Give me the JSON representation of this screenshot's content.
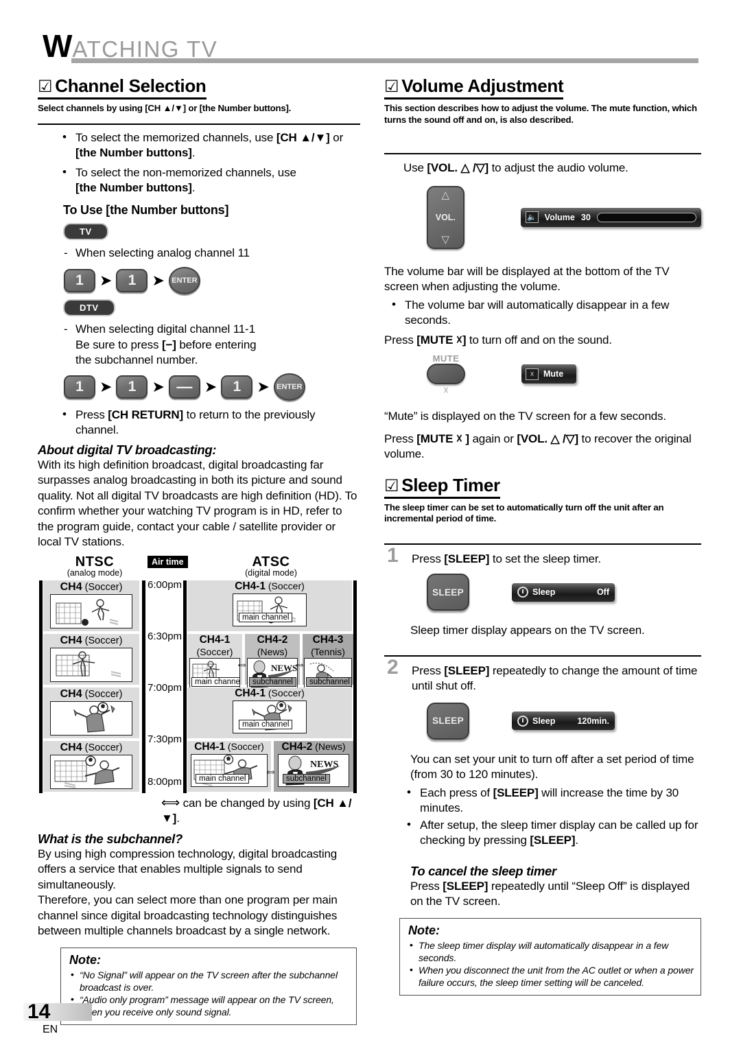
{
  "header": {
    "cap": "W",
    "rest": "ATCHING  TV"
  },
  "left": {
    "section1": {
      "check": "☑",
      "title": "Channel Selection",
      "lead": "Select channels by using [CH ▲/▼] or [the Number buttons].",
      "b1_a": "To select the memorized channels, use ",
      "b1_b": "[CH ▲/▼]",
      "b1_c": " or",
      "b1_d": "[the Number buttons]",
      "b1_e": ".",
      "b2_a": "To select the non-memorized channels, use",
      "b2_b": "[the Number buttons]",
      "b2_c": ".",
      "subhead": "To Use [the Number buttons]",
      "badge_tv": "TV",
      "badge_dtv": "DTV",
      "analog_line": "When selecting analog channel 11",
      "digital_line1": "When selecting digital channel 11-1",
      "digital_line2_a": "Be sure to press ",
      "digital_line2_b": "[−]",
      "digital_line2_c": " before entering",
      "digital_line3": "the subchannel number.",
      "keys_analog": [
        "1",
        "1",
        "ENTER"
      ],
      "keys_digital": [
        "1",
        "1",
        "—",
        "1",
        "ENTER"
      ],
      "b3_a": "Press ",
      "b3_b": "[CH RETURN]",
      "b3_c": " to return to the previously",
      "b3_d": "channel.",
      "about_head": "About digital TV broadcasting:",
      "about_body": "With its high definition broadcast, digital broadcasting far surpasses analog broadcasting in both its picture and sound quality. Not all digital TV broadcasts are high definition (HD). To confirm whether your watching TV program is in HD, refer to the program guide, contact your cable / satellite provider or local TV stations.",
      "sub_head": "What is the subchannel?",
      "sub_p1": "By using high compression technology, digital broadcasting offers a service that enables multiple signals to send simultaneously.",
      "sub_p2": "Therefore, you can select more than one program per main channel since digital broadcasting technology distinguishes between multiple channels broadcast by a single network."
    },
    "diagram": {
      "ntsc_title": "NTSC",
      "ntsc_sub": "(analog mode)",
      "atsc_title": "ATSC",
      "atsc_sub": "(digital mode)",
      "airtime": "Air time",
      "times": [
        "6:00pm",
        "6:30pm",
        "7:00pm",
        "7:30pm",
        "8:00pm"
      ],
      "ntsc_cells": [
        {
          "ch": "CH4",
          "prog": "(Soccer)"
        },
        {
          "ch": "CH4",
          "prog": "(Soccer)"
        },
        {
          "ch": "CH4",
          "prog": "(Soccer)"
        },
        {
          "ch": "CH4",
          "prog": "(Soccer)"
        }
      ],
      "atsc_cells": [
        {
          "ch": "CH4-1",
          "prog": "(Soccer)",
          "tag": "main channel"
        },
        {
          "ch": "CH4-1",
          "prog": "(Soccer)",
          "tag": "main channel"
        },
        {
          "ch": "CH4-2",
          "prog": "(News)",
          "tag": "subchannel"
        },
        {
          "ch": "CH4-3",
          "prog": "(Tennis)",
          "tag": "subchannel"
        },
        {
          "ch": "CH4-1",
          "prog": "(Soccer)",
          "tag": "main channel"
        },
        {
          "ch": "CH4-1",
          "prog": "(Soccer)",
          "tag": "main channel"
        },
        {
          "ch": "CH4-2",
          "prog": "(News)",
          "tag": "subchannel"
        }
      ],
      "footnote_a": "⟺",
      "footnote_b": " can be changed by using ",
      "footnote_c": "[CH ▲/▼]",
      "footnote_d": "."
    },
    "note": {
      "title": "Note:",
      "items": [
        "“No Signal” will appear on the TV screen after the subchannel broadcast is over.",
        "“Audio only program” message will appear on the TV screen, when you receive only sound signal."
      ]
    }
  },
  "right": {
    "volume": {
      "check": "☑",
      "title": "Volume Adjustment",
      "lead": "This section describes how to adjust the volume. The mute function, which turns the sound off and on, is also described.",
      "use_a": "Use ",
      "use_b": "[VOL. △ /▽]",
      "use_c": " to adjust the audio volume.",
      "vol_key_up": "△",
      "vol_key_label": "VOL.",
      "vol_key_down": "▽",
      "osd_volume_icon": "◀र",
      "osd_volume_label": "Volume",
      "osd_volume_value": "30",
      "osd_volume_percent": 30,
      "p1": "The volume bar will be displayed at the bottom of the TV screen when adjusting the volume.",
      "b1": "The volume bar will automatically disappear in a few seconds.",
      "p2_a": "Press ",
      "p2_b": "[MUTE ☓]",
      "p2_c": " to turn off and on the sound.",
      "mute_cap": "MUTE",
      "mute_glyph": "☓",
      "osd_mute_icon": "☓",
      "osd_mute_label": "Mute",
      "p3": "“Mute” is displayed on the TV screen for a few seconds.",
      "p4_a": "Press ",
      "p4_b": "[MUTE ☓ ]",
      "p4_c": " again or ",
      "p4_d": "[VOL. △ /▽]",
      "p4_e": " to recover the original volume."
    },
    "sleep": {
      "check": "☑",
      "title": "Sleep Timer",
      "lead": "The sleep timer can be set to automatically turn off the unit after an incremental period of time.",
      "step1_num": "1",
      "step1_a": "Press ",
      "step1_b": "[SLEEP]",
      "step1_c": " to set the sleep timer.",
      "key_sleep": "SLEEP",
      "osd1_label": "Sleep",
      "osd1_value": "Off",
      "after1": "Sleep timer display appears on the TV screen.",
      "step2_num": "2",
      "step2_a": "Press ",
      "step2_b": "[SLEEP]",
      "step2_c": " repeatedly to change the amount of time until shut off.",
      "osd2_label": "Sleep",
      "osd2_value": "120min.",
      "after2": "You can set your unit to turn off after a set period of time (from 30 to 120 minutes).",
      "b1_a": "Each press of ",
      "b1_b": "[SLEEP]",
      "b1_c": " will increase the time by 30 minutes.",
      "b2_a": "After setup, the sleep timer display can be called up for checking by pressing ",
      "b2_b": "[SLEEP]",
      "b2_c": ".",
      "cancel_head": "To cancel the sleep timer",
      "cancel_a": "Press ",
      "cancel_b": "[SLEEP]",
      "cancel_c": " repeatedly until “Sleep Off” is displayed on the TV screen.",
      "note": {
        "title": "Note:",
        "items": [
          "The sleep timer display will automatically disappear in a few seconds.",
          "When you disconnect the unit from the AC outlet or when a power failure occurs, the sleep timer setting will be canceled."
        ]
      }
    }
  },
  "footer": {
    "page": "14",
    "lang": "EN"
  }
}
